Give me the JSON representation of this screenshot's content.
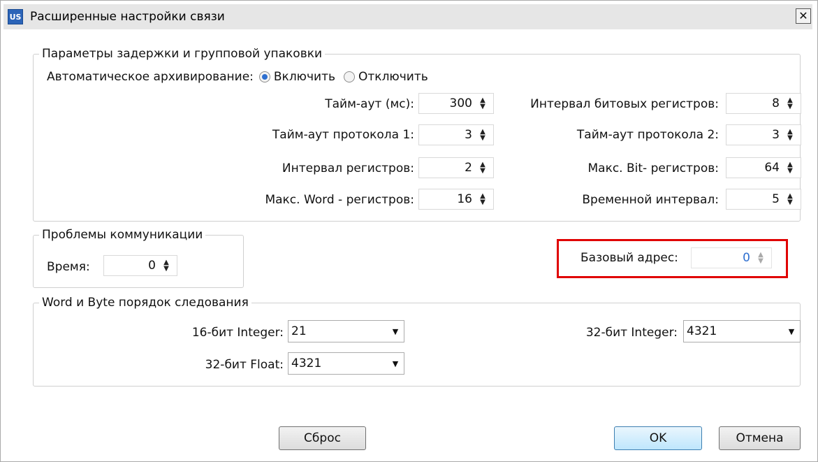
{
  "window": {
    "icon_text": "US",
    "title": "Расширенные настройки связи",
    "close_glyph": "✕"
  },
  "delay_group": {
    "legend": "Параметры задержки и групповой упаковки",
    "auto_archive_label": "Автоматическое архивирование:",
    "radio_enable": "Включить",
    "radio_disable": "Отключить",
    "auto_archive_selected": "Включить",
    "fields": {
      "timeout": {
        "label": "Тайм-аут (мс):",
        "value": "300"
      },
      "bit_interval": {
        "label": "Интервал битовых регистров:",
        "value": "8"
      },
      "protocol1": {
        "label": "Тайм-аут протокола 1:",
        "value": "3"
      },
      "protocol2": {
        "label": "Тайм-аут протокола 2:",
        "value": "3"
      },
      "reg_interval": {
        "label": "Интервал регистров:",
        "value": "2"
      },
      "max_bit": {
        "label": "Макс. Bit- регистров:",
        "value": "64"
      },
      "max_word": {
        "label": "Макс. Word - регистров:",
        "value": "16"
      },
      "time_interval": {
        "label": "Временной интервал:",
        "value": "5"
      }
    }
  },
  "comm_group": {
    "legend": "Проблемы коммуникации",
    "time_label": "Время:",
    "time_value": "0"
  },
  "base_address": {
    "label": "Базовый адрес:",
    "value": "0"
  },
  "order_group": {
    "legend": "Word и Byte порядок следования",
    "int16": {
      "label": "16-бит Integer:",
      "value": "21"
    },
    "int32": {
      "label": "32-бит Integer:",
      "value": "4321"
    },
    "float32": {
      "label": "32-бит Float:",
      "value": "4321"
    }
  },
  "buttons": {
    "reset": "Сброс",
    "ok": "OK",
    "cancel": "Отмена"
  },
  "colors": {
    "highlight": "#e00000",
    "accent": "#2e6fd0"
  }
}
